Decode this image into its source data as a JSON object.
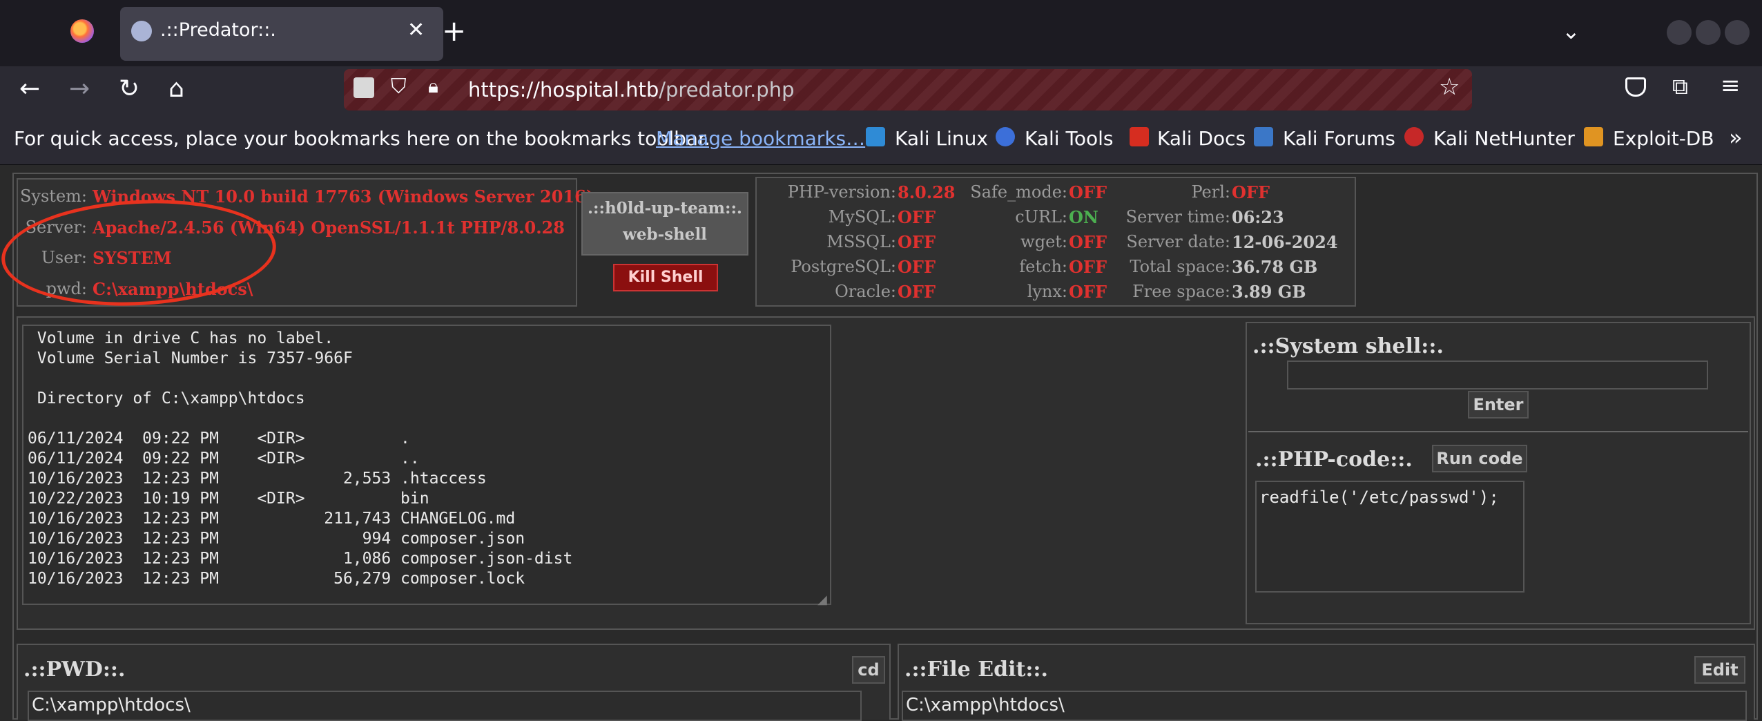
{
  "browser": {
    "tab_title": ".::Predator::.",
    "url_host": "https://hospital.htb",
    "url_path": "/predator.php",
    "bookmarks_hint": "For quick access, place your bookmarks here on the bookmarks toolbar.",
    "manage_link": "Manage bookmarks…",
    "bookmarks": [
      "Kali Linux",
      "Kali Tools",
      "Kali Docs",
      "Kali Forums",
      "Kali NetHunter",
      "Exploit-DB"
    ]
  },
  "sysinfo": {
    "system_label": "System:",
    "system_value": "Windows NT 10.0 build 17763 (Windows Server 2016)",
    "server_label": "Server:",
    "server_value": "Apache/2.4.56 (Win64) OpenSSL/1.1.1t PHP/8.0.28",
    "user_label": "User:",
    "user_value": "SYSTEM",
    "pwd_label": "pwd:",
    "pwd_value": "C:\\xampp\\htdocs\\"
  },
  "brand": {
    "line1": ".::h0ld-up-team::.",
    "line2": "web-shell",
    "kill_label": "Kill Shell"
  },
  "php_info": {
    "php_version_label": "PHP-version:",
    "php_version": "8.0.28",
    "mysql_label": "MySQL:",
    "mysql": "OFF",
    "mssql_label": "MSSQL:",
    "mssql": "OFF",
    "postgresql_label": "PostgreSQL:",
    "postgresql": "OFF",
    "oracle_label": "Oracle:",
    "oracle": "OFF",
    "safe_mode_label": "Safe_mode:",
    "safe_mode": "OFF",
    "curl_label": "cURL:",
    "curl": "ON",
    "wget_label": "wget:",
    "wget": "OFF",
    "fetch_label": "fetch:",
    "fetch": "OFF",
    "lynx_label": "lynx:",
    "lynx": "OFF",
    "perl_label": "Perl:",
    "perl": "OFF",
    "server_time_label": "Server time:",
    "server_time": "06:23",
    "server_date_label": "Server date:",
    "server_date": "12-06-2024",
    "total_space_label": "Total space:",
    "total_space": "36.78 GB",
    "free_space_label": "Free space:",
    "free_space": "3.89 GB"
  },
  "output": {
    "text": " Volume in drive C has no label.\n Volume Serial Number is 7357-966F\n\n Directory of C:\\xampp\\htdocs\n\n06/11/2024  09:22 PM    <DIR>          .\n06/11/2024  09:22 PM    <DIR>          ..\n10/16/2023  12:23 PM             2,553 .htaccess\n10/22/2023  10:19 PM    <DIR>          bin\n10/16/2023  12:23 PM           211,743 CHANGELOG.md\n10/16/2023  12:23 PM               994 composer.json\n10/16/2023  12:23 PM             1,086 composer.json-dist\n10/16/2023  12:23 PM            56,279 composer.lock"
  },
  "system_shell": {
    "title": ".::System shell::.",
    "input_value": "",
    "enter_label": "Enter"
  },
  "php_code": {
    "title": ".::PHP-code::.",
    "run_label": "Run code",
    "code": "readfile('/etc/passwd');"
  },
  "pwd_panel": {
    "title": ".::PWD::.",
    "cd_label": "cd",
    "value": "C:\\xampp\\htdocs\\"
  },
  "file_edit": {
    "title": ".::File Edit::.",
    "edit_label": "Edit",
    "value": "C:\\xampp\\htdocs\\"
  },
  "colors": {
    "accent_red": "#e0312f",
    "on_green": "#4caf50",
    "circle": "#e8321e"
  }
}
